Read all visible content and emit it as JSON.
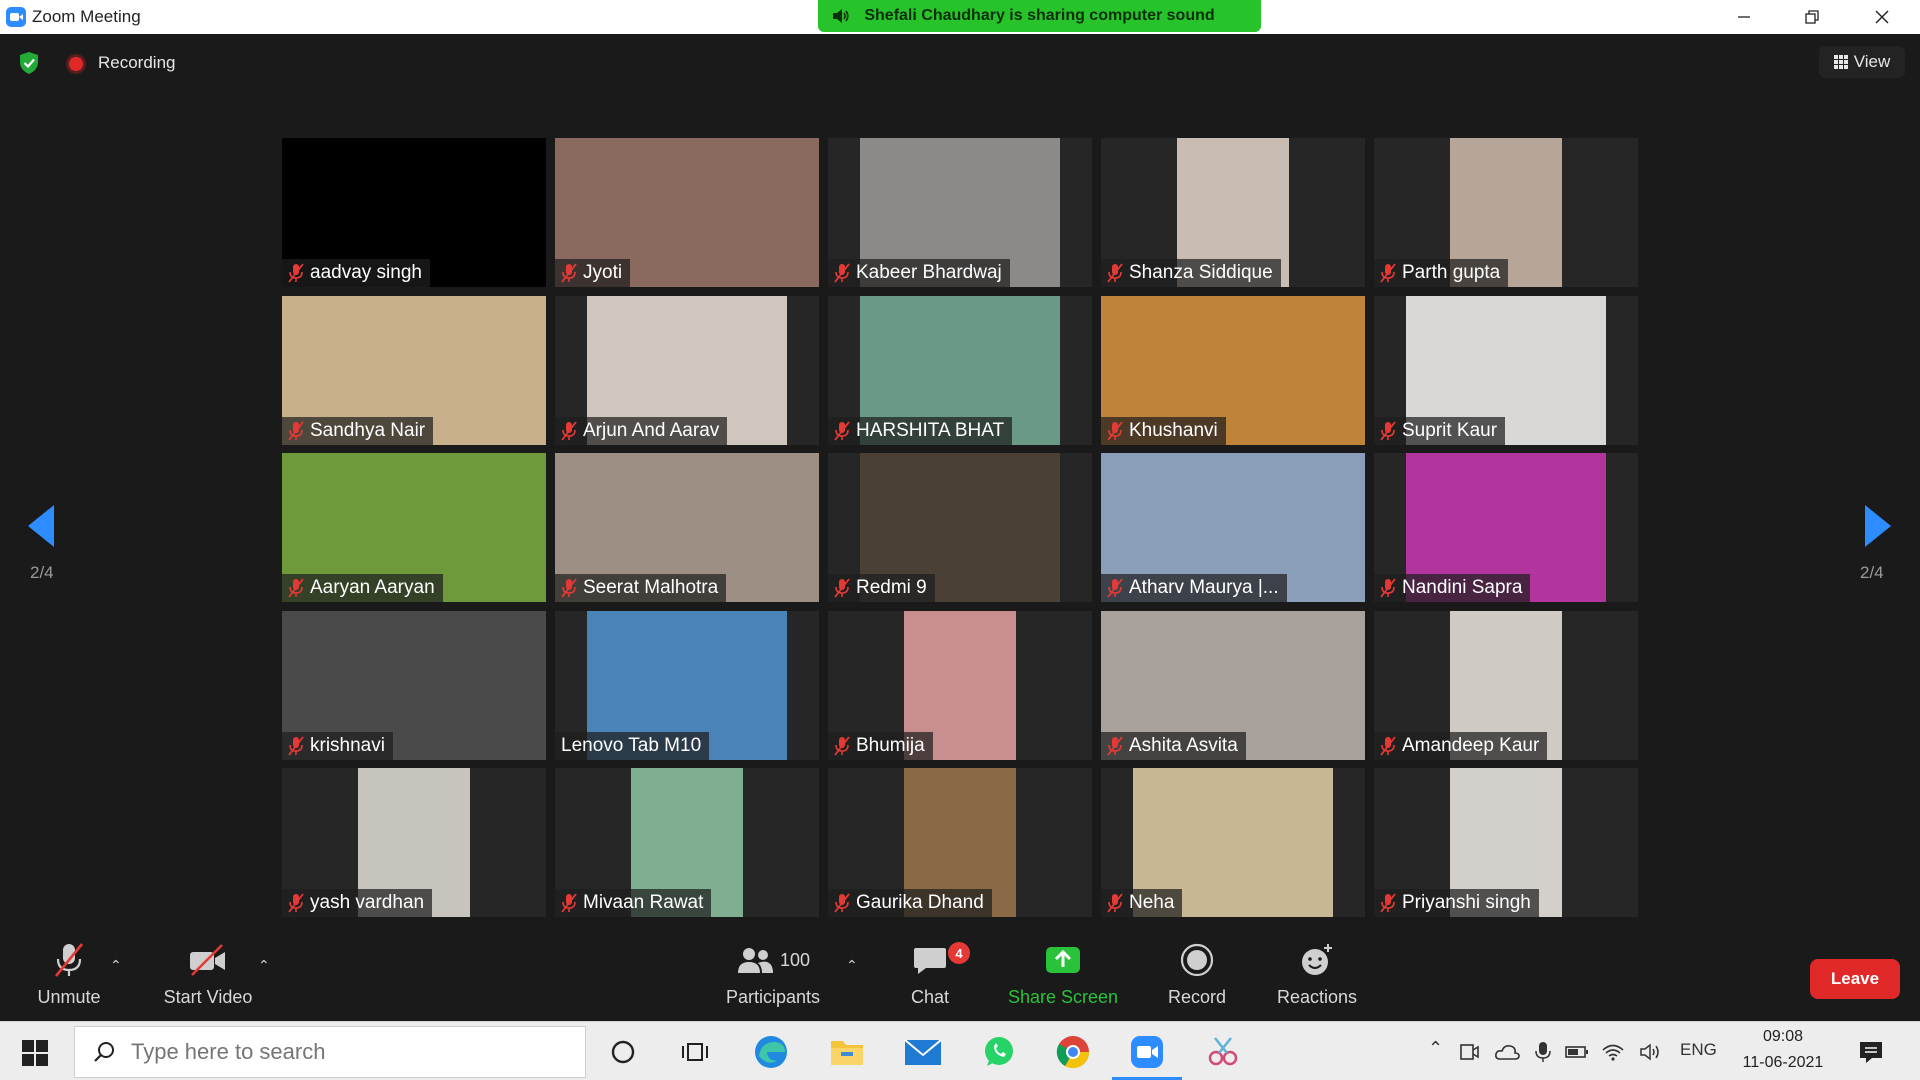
{
  "window": {
    "title": "Zoom Meeting",
    "share_banner": "Shefali Chaudhary is sharing computer sound"
  },
  "top": {
    "recording_label": "Recording",
    "view_label": "View"
  },
  "pagination": {
    "left": "2/4",
    "right": "2/4"
  },
  "participants_grid": [
    {
      "name": "aadvay singh",
      "muted": true
    },
    {
      "name": "Jyoti",
      "muted": true
    },
    {
      "name": "Kabeer Bhardwaj",
      "muted": true
    },
    {
      "name": "Shanza Siddique",
      "muted": true
    },
    {
      "name": "Parth gupta",
      "muted": true
    },
    {
      "name": "Sandhya Nair",
      "muted": true
    },
    {
      "name": "Arjun And Aarav",
      "muted": true
    },
    {
      "name": "HARSHITA BHAT",
      "muted": true
    },
    {
      "name": "Khushanvi",
      "muted": true
    },
    {
      "name": "Suprit Kaur",
      "muted": true
    },
    {
      "name": "Aaryan Aaryan",
      "muted": true
    },
    {
      "name": "Seerat Malhotra",
      "muted": true
    },
    {
      "name": "Redmi 9",
      "muted": true
    },
    {
      "name": "Atharv Maurya |...",
      "muted": true
    },
    {
      "name": "Nandini Sapra",
      "muted": true
    },
    {
      "name": "krishnavi",
      "muted": true
    },
    {
      "name": "Lenovo Tab M10",
      "muted": false
    },
    {
      "name": "Bhumija",
      "muted": true
    },
    {
      "name": "Ashita Asvita",
      "muted": true
    },
    {
      "name": "Amandeep Kaur",
      "muted": true
    },
    {
      "name": "yash vardhan",
      "muted": true
    },
    {
      "name": "Mivaan Rawat",
      "muted": true
    },
    {
      "name": "Gaurika Dhand",
      "muted": true
    },
    {
      "name": "Neha",
      "muted": true
    },
    {
      "name": "Priyanshi singh",
      "muted": true
    }
  ],
  "toolbar": {
    "unmute": "Unmute",
    "start_video": "Start Video",
    "participants_count": "100",
    "participants": "Participants",
    "chat": "Chat",
    "chat_badge": "4",
    "share_screen": "Share Screen",
    "record": "Record",
    "reactions": "Reactions",
    "leave": "Leave"
  },
  "taskbar": {
    "search_placeholder": "Type here to search",
    "language": "ENG",
    "time": "09:08",
    "date": "11-06-2021"
  },
  "colors": {
    "accent": "#2d8cff",
    "share_green": "#26c32a",
    "leave_red": "#e02828",
    "muted_red": "#e53935"
  }
}
